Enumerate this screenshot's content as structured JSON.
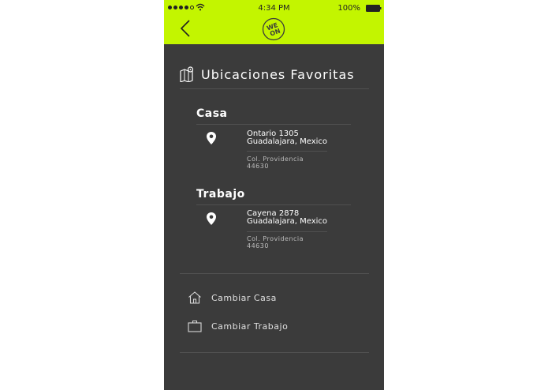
{
  "status_bar": {
    "time": "4:34 PM",
    "battery": "100%"
  },
  "header": {
    "logo_text": "WE ON"
  },
  "favorites": {
    "title": "Ubicaciones Favoritas",
    "places": [
      {
        "name": "Casa",
        "address_line1": "Ontario 1305",
        "address_line2": "Guadalajara, Mexico",
        "colony": "Col. Providencia",
        "zip": "44630"
      },
      {
        "name": "Trabajo",
        "address_line1": "Cayena 2878",
        "address_line2": "Guadalajara, Mexico",
        "colony": "Col. Providencia",
        "zip": "44630"
      }
    ]
  },
  "actions": {
    "change_home": "Cambiar Casa",
    "change_work": "Cambiar Trabajo"
  },
  "colors": {
    "accent": "#c3f500",
    "background": "#3b3b3b"
  },
  "icons": [
    "back-arrow-icon",
    "map-icon",
    "location-pin-icon",
    "home-icon",
    "briefcase-icon"
  ]
}
